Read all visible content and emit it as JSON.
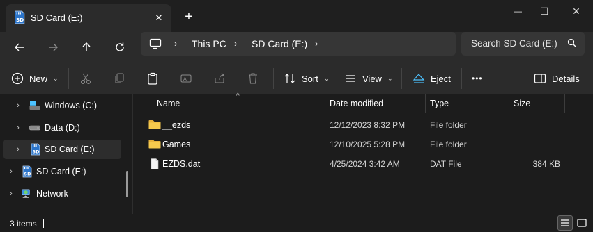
{
  "tab": {
    "title": "SD Card (E:)",
    "close": "✕",
    "new": "+"
  },
  "window": {
    "minimize": "—",
    "maximize": "☐",
    "close": "✕"
  },
  "breadcrumb": {
    "items": [
      "This PC",
      "SD Card (E:)"
    ]
  },
  "search": {
    "placeholder": "Search SD Card (E:)"
  },
  "toolbar": {
    "new_label": "New",
    "sort_label": "Sort",
    "view_label": "View",
    "eject_label": "Eject",
    "more_label": "•••",
    "details_label": "Details"
  },
  "nav": {
    "items": [
      {
        "label": "Windows (C:)"
      },
      {
        "label": "Data (D:)"
      },
      {
        "label": "SD Card (E:)"
      },
      {
        "label": "SD Card (E:)"
      },
      {
        "label": "Network"
      }
    ]
  },
  "columns": {
    "name": "Name",
    "date": "Date modified",
    "type": "Type",
    "size": "Size"
  },
  "files": [
    {
      "name": "__ezds",
      "date": "12/12/2023 8:32 PM",
      "type": "File folder",
      "size": ""
    },
    {
      "name": "Games",
      "date": "12/10/2025 5:28 PM",
      "type": "File folder",
      "size": ""
    },
    {
      "name": "EZDS.dat",
      "date": "4/25/2024 3:42 AM",
      "type": "DAT File",
      "size": "384 KB"
    }
  ],
  "status": {
    "count": "3 items"
  },
  "colors": {
    "accent": "#4cc2ff",
    "folder": "#f4c542",
    "background": "#1c1c1c"
  }
}
